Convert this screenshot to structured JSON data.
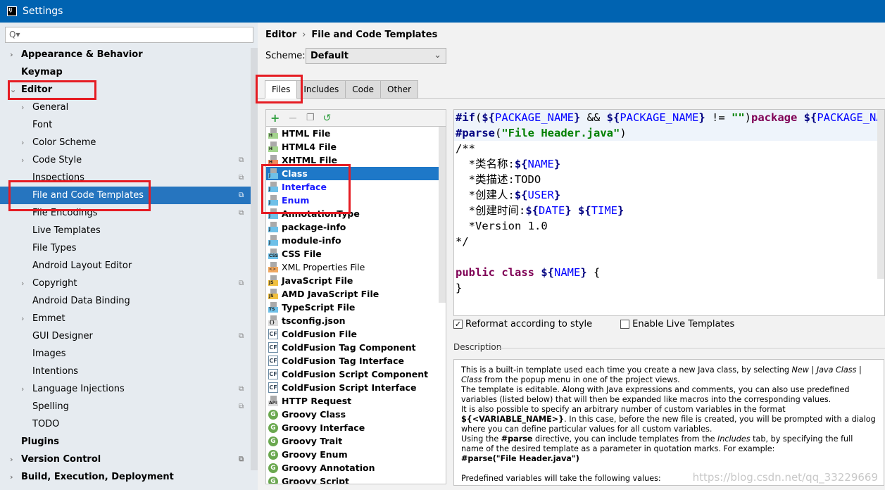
{
  "window": {
    "title": "Settings",
    "logo": "IJ"
  },
  "sidebar": {
    "search_placeholder": "Q▾",
    "items": [
      {
        "label": "Appearance & Behavior",
        "level": 0,
        "bold": true,
        "arrow": "›"
      },
      {
        "label": "Keymap",
        "level": 0,
        "bold": true
      },
      {
        "label": "Editor",
        "level": 0,
        "bold": true,
        "arrow": "⌄"
      },
      {
        "label": "General",
        "level": 1,
        "arrow": "›"
      },
      {
        "label": "Font",
        "level": 1
      },
      {
        "label": "Color Scheme",
        "level": 1,
        "arrow": "›"
      },
      {
        "label": "Code Style",
        "level": 1,
        "arrow": "›",
        "copy": true
      },
      {
        "label": "Inspections",
        "level": 1,
        "copy": true
      },
      {
        "label": "File and Code Templates",
        "level": 1,
        "copy": true,
        "selected": true
      },
      {
        "label": "File Encodings",
        "level": 1,
        "copy": true
      },
      {
        "label": "Live Templates",
        "level": 1
      },
      {
        "label": "File Types",
        "level": 1
      },
      {
        "label": "Android Layout Editor",
        "level": 1
      },
      {
        "label": "Copyright",
        "level": 1,
        "arrow": "›",
        "copy": true
      },
      {
        "label": "Android Data Binding",
        "level": 1
      },
      {
        "label": "Emmet",
        "level": 1,
        "arrow": "›"
      },
      {
        "label": "GUI Designer",
        "level": 1,
        "copy": true
      },
      {
        "label": "Images",
        "level": 1
      },
      {
        "label": "Intentions",
        "level": 1
      },
      {
        "label": "Language Injections",
        "level": 1,
        "arrow": "›",
        "copy": true
      },
      {
        "label": "Spelling",
        "level": 1,
        "copy": true
      },
      {
        "label": "TODO",
        "level": 1
      },
      {
        "label": "Plugins",
        "level": 0,
        "bold": true
      },
      {
        "label": "Version Control",
        "level": 0,
        "bold": true,
        "arrow": "›",
        "copy": true
      },
      {
        "label": "Build, Execution, Deployment",
        "level": 0,
        "bold": true,
        "arrow": "›"
      }
    ]
  },
  "main": {
    "breadcrumb": [
      "Editor",
      "File and Code Templates"
    ],
    "breadcrumb_sep": "›",
    "scheme_label": "Scheme:",
    "scheme_value": "Default",
    "tabs": [
      {
        "label": "Files",
        "active": true
      },
      {
        "label": "Includes"
      },
      {
        "label": "Code"
      },
      {
        "label": "Other"
      }
    ],
    "toolbar": [
      "add-icon",
      "remove-icon",
      "copy-icon",
      "reset-icon"
    ],
    "files": [
      {
        "label": "HTML File",
        "icon": "H",
        "color": "#a3d48e"
      },
      {
        "label": "HTML4 File",
        "icon": "H",
        "color": "#a3d48e"
      },
      {
        "label": "XHTML File",
        "icon": "H",
        "color": "#f08a5d"
      },
      {
        "label": "Class",
        "icon": "J",
        "color": "#6ec0e8",
        "selected": true
      },
      {
        "label": "Interface",
        "icon": "J",
        "color": "#6ec0e8",
        "blue": true
      },
      {
        "label": "Enum",
        "icon": "J",
        "color": "#6ec0e8",
        "blue": true
      },
      {
        "label": "AnnotationType",
        "icon": "J",
        "color": "#6ec0e8"
      },
      {
        "label": "package-info",
        "icon": "J",
        "color": "#6ec0e8"
      },
      {
        "label": "module-info",
        "icon": "J",
        "color": "#6ec0e8"
      },
      {
        "label": "CSS File",
        "icon": "CSS",
        "color": "#6ec0e8"
      },
      {
        "label": "XML Properties File",
        "icon": "<>",
        "color": "#f0a860",
        "normal": true
      },
      {
        "label": "JavaScript File",
        "icon": "JS",
        "color": "#f0c040"
      },
      {
        "label": "AMD JavaScript File",
        "icon": "JS",
        "color": "#f0c040"
      },
      {
        "label": "TypeScript File",
        "icon": "TS",
        "color": "#6ec0e8"
      },
      {
        "label": "tsconfig.json",
        "icon": "{}",
        "color": "#ddd"
      },
      {
        "label": "ColdFusion File",
        "icon": "CF",
        "type": "cf"
      },
      {
        "label": "ColdFusion Tag Component",
        "icon": "CF",
        "type": "cf"
      },
      {
        "label": "ColdFusion Tag Interface",
        "icon": "CF",
        "type": "cf"
      },
      {
        "label": "ColdFusion Script Component",
        "icon": "CF",
        "type": "cf"
      },
      {
        "label": "ColdFusion Script Interface",
        "icon": "CF",
        "type": "cf"
      },
      {
        "label": "HTTP Request",
        "icon": "API",
        "color": "#ddd"
      },
      {
        "label": "Groovy Class",
        "icon": "G",
        "type": "g"
      },
      {
        "label": "Groovy Interface",
        "icon": "G",
        "type": "g"
      },
      {
        "label": "Groovy Trait",
        "icon": "G",
        "type": "g"
      },
      {
        "label": "Groovy Enum",
        "icon": "G",
        "type": "g"
      },
      {
        "label": "Groovy Annotation",
        "icon": "G",
        "type": "g"
      },
      {
        "label": "Groovy Script",
        "icon": "G",
        "type": "g"
      }
    ],
    "code": [
      [
        [
          "kw",
          "#if"
        ],
        [
          "",
          "("
        ],
        [
          "kw",
          "${"
        ],
        [
          "vr",
          "PACKAGE_NAME"
        ],
        [
          "kw",
          "}"
        ],
        [
          "",
          " && "
        ],
        [
          "kw",
          "${"
        ],
        [
          "vr",
          "PACKAGE_NAME"
        ],
        [
          "kw",
          "}"
        ],
        [
          "",
          " != "
        ],
        [
          "st",
          "\"\""
        ],
        [
          "",
          ")"
        ],
        [
          "pk",
          "package "
        ],
        [
          "kw",
          "${"
        ],
        [
          "vr",
          "PACKAGE_NAME"
        ],
        [
          "kw",
          "}"
        ]
      ],
      [
        [
          "kw",
          "#parse"
        ],
        [
          "",
          "("
        ],
        [
          "st",
          "\"File Header.java\""
        ],
        [
          "",
          ")"
        ]
      ],
      [
        [
          "",
          "/**"
        ]
      ],
      [
        [
          "",
          "  *类名称:"
        ],
        [
          "kw",
          "${"
        ],
        [
          "vr",
          "NAME"
        ],
        [
          "kw",
          "}"
        ]
      ],
      [
        [
          "",
          "  *类描述:TODO"
        ]
      ],
      [
        [
          "",
          "  *创建人:"
        ],
        [
          "kw",
          "${"
        ],
        [
          "vr",
          "USER"
        ],
        [
          "kw",
          "}"
        ]
      ],
      [
        [
          "",
          "  *创建时间:"
        ],
        [
          "kw",
          "${"
        ],
        [
          "vr",
          "DATE"
        ],
        [
          "kw",
          "}"
        ],
        [
          "",
          " "
        ],
        [
          "kw",
          "${"
        ],
        [
          "vr",
          "TIME"
        ],
        [
          "kw",
          "}"
        ]
      ],
      [
        [
          "",
          "  *Version 1.0"
        ]
      ],
      [
        [
          "",
          "*/"
        ]
      ],
      [
        [
          "",
          ""
        ]
      ],
      [
        [
          "pk",
          "public class "
        ],
        [
          "kw",
          "${"
        ],
        [
          "vr",
          "NAME"
        ],
        [
          "kw",
          "}"
        ],
        [
          "",
          " {"
        ]
      ],
      [
        [
          "",
          "}"
        ]
      ]
    ],
    "reformat_label": "Reformat according to style",
    "reformat_checked": true,
    "live_label": "Enable Live Templates",
    "live_checked": false,
    "description_label": "Description",
    "description": [
      "This is a built-in template used each time you create a new Java class, by selecting <i>New</i> | <i>Java Class</i> | <i>Class</i> from the popup menu in one of the project views.",
      "The template is editable. Along with Java expressions and comments, you can also use predefined variables (listed below) that will then be expanded like macros into the corresponding values.",
      "It is also possible to specify an arbitrary number of custom variables in the format <b>${&lt;VARIABLE_NAME&gt;}</b>. In this case, before the new file is created, you will be prompted with a dialog where you can define particular values for all custom variables.",
      "Using the <b>#parse</b> directive, you can include templates from the <i>Includes</i> tab, by specifying the full name of the desired template as a parameter in quotation marks. For example:",
      "<b>#parse(\"File Header.java\")</b>",
      "<br>Predefined variables will take the following values:"
    ],
    "watermark": "https://blog.csdn.net/qq_33229669"
  },
  "colors": {
    "accent": "#0063b1",
    "selection": "#2675bf",
    "highlight": "#e51c23"
  }
}
